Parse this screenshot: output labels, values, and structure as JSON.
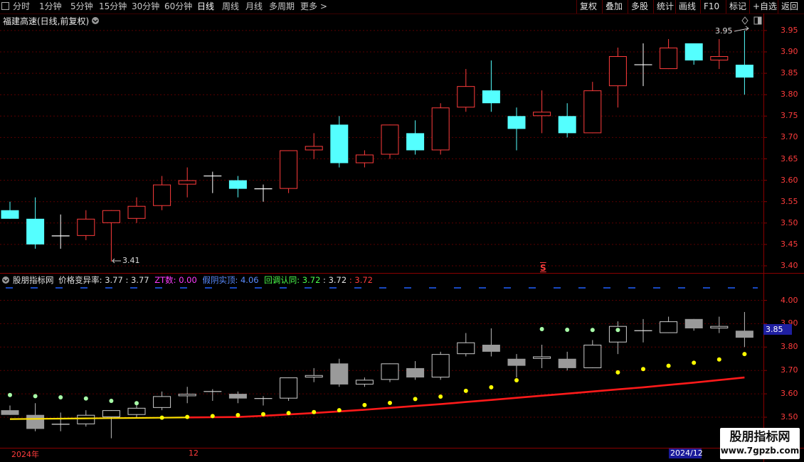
{
  "toolbar": {
    "periods": [
      "分时",
      "1分钟",
      "5分钟",
      "15分钟",
      "30分钟",
      "60分钟",
      "日线",
      "周线",
      "月线",
      "多周期",
      "更多 >"
    ],
    "active_period": "日线",
    "right_buttons": [
      "复权",
      "叠加",
      "多股",
      "统计",
      "画线",
      "F10",
      "标记",
      "+自选",
      "返回"
    ]
  },
  "main_chart": {
    "title": "福建高速(日线,前复权)",
    "high_marker": "3.95",
    "low_marker": "3.41",
    "s_marker": "S",
    "y_ticks": [
      "3.95",
      "3.90",
      "3.85",
      "3.80",
      "3.75",
      "3.70",
      "3.65",
      "3.60",
      "3.55",
      "3.50",
      "3.45",
      "3.40"
    ],
    "colors": {
      "up": "#ff3c3c",
      "down": "#54ffff",
      "flat": "#ffffff",
      "grid": "#5a0000"
    }
  },
  "indicator": {
    "name": "股朋指标网",
    "line1_label": "价格变异率:",
    "line1_value1": "3.77",
    "line1_value2": ": 3.77",
    "zt_label": "ZT数:",
    "zt_value": "0.00",
    "jy_label": "假阴实顶:",
    "jy_value": "4.06",
    "ht_label": "回调认同:",
    "ht_value": "3.72",
    "ht_value2": ": 3.72",
    "ht_value3": ": 3.72",
    "y_ticks": [
      "4.00",
      "3.90",
      "3.80",
      "3.70",
      "3.60",
      "3.50"
    ],
    "current_price": "3.85"
  },
  "x_axis": {
    "start_label": "2024年",
    "mid_label": "12",
    "end_label": "2024/12"
  },
  "watermark": {
    "line1": "股朋指标网",
    "line2": "www.7gpzb.com"
  },
  "chart_data": {
    "type": "candlestick",
    "series": [
      {
        "o": 3.53,
        "h": 3.55,
        "l": 3.51,
        "c": 3.51
      },
      {
        "o": 3.51,
        "h": 3.56,
        "l": 3.44,
        "c": 3.45
      },
      {
        "o": 3.47,
        "h": 3.52,
        "l": 3.44,
        "c": 3.47
      },
      {
        "o": 3.47,
        "h": 3.53,
        "l": 3.46,
        "c": 3.51
      },
      {
        "o": 3.5,
        "h": 3.53,
        "l": 3.41,
        "c": 3.53
      },
      {
        "o": 3.51,
        "h": 3.56,
        "l": 3.5,
        "c": 3.54
      },
      {
        "o": 3.54,
        "h": 3.61,
        "l": 3.53,
        "c": 3.59
      },
      {
        "o": 3.59,
        "h": 3.63,
        "l": 3.56,
        "c": 3.6
      },
      {
        "o": 3.61,
        "h": 3.62,
        "l": 3.57,
        "c": 3.61
      },
      {
        "o": 3.6,
        "h": 3.61,
        "l": 3.56,
        "c": 3.58
      },
      {
        "o": 3.58,
        "h": 3.59,
        "l": 3.55,
        "c": 3.58
      },
      {
        "o": 3.58,
        "h": 3.67,
        "l": 3.57,
        "c": 3.67
      },
      {
        "o": 3.67,
        "h": 3.71,
        "l": 3.65,
        "c": 3.68
      },
      {
        "o": 3.73,
        "h": 3.75,
        "l": 3.63,
        "c": 3.64
      },
      {
        "o": 3.64,
        "h": 3.67,
        "l": 3.63,
        "c": 3.66
      },
      {
        "o": 3.66,
        "h": 3.73,
        "l": 3.65,
        "c": 3.73
      },
      {
        "o": 3.71,
        "h": 3.74,
        "l": 3.66,
        "c": 3.67
      },
      {
        "o": 3.67,
        "h": 3.78,
        "l": 3.66,
        "c": 3.77
      },
      {
        "o": 3.77,
        "h": 3.86,
        "l": 3.76,
        "c": 3.82
      },
      {
        "o": 3.81,
        "h": 3.88,
        "l": 3.76,
        "c": 3.78
      },
      {
        "o": 3.75,
        "h": 3.77,
        "l": 3.67,
        "c": 3.72
      },
      {
        "o": 3.75,
        "h": 3.81,
        "l": 3.71,
        "c": 3.76
      },
      {
        "o": 3.75,
        "h": 3.78,
        "l": 3.7,
        "c": 3.71
      },
      {
        "o": 3.71,
        "h": 3.83,
        "l": 3.71,
        "c": 3.81
      },
      {
        "o": 3.82,
        "h": 3.91,
        "l": 3.77,
        "c": 3.89
      },
      {
        "o": 3.87,
        "h": 3.92,
        "l": 3.82,
        "c": 3.87
      },
      {
        "o": 3.86,
        "h": 3.93,
        "l": 3.86,
        "c": 3.91
      },
      {
        "o": 3.92,
        "h": 3.92,
        "l": 3.87,
        "c": 3.88
      },
      {
        "o": 3.88,
        "h": 3.93,
        "l": 3.86,
        "c": 3.89
      },
      {
        "o": 3.87,
        "h": 3.95,
        "l": 3.8,
        "c": 3.84
      }
    ],
    "ma_line": [
      3.492,
      3.493,
      3.494,
      3.495,
      3.496,
      3.497,
      3.498,
      3.499,
      3.5,
      3.501,
      3.506,
      3.512,
      3.518,
      3.525,
      3.532,
      3.54,
      3.548,
      3.556,
      3.565,
      3.574,
      3.583,
      3.592,
      3.601,
      3.61,
      3.619,
      3.628,
      3.638,
      3.648,
      3.659,
      3.67
    ],
    "yellow_dots": [
      null,
      null,
      null,
      null,
      null,
      null,
      3.498,
      3.501,
      3.505,
      3.509,
      3.513,
      3.518,
      3.522,
      3.53,
      3.552,
      3.561,
      3.578,
      3.588,
      3.613,
      3.628,
      3.658,
      null,
      null,
      null,
      3.692,
      3.706,
      3.72,
      3.733,
      3.747,
      3.77
    ],
    "green_dots": [
      3.595,
      3.59,
      3.585,
      3.58,
      3.57,
      3.56,
      null,
      null,
      null,
      null,
      null,
      null,
      null,
      null,
      null,
      null,
      null,
      null,
      null,
      null,
      null,
      3.877,
      3.874,
      3.873,
      3.873,
      null,
      null,
      null,
      null,
      null
    ],
    "dashed_level": 4.06
  }
}
